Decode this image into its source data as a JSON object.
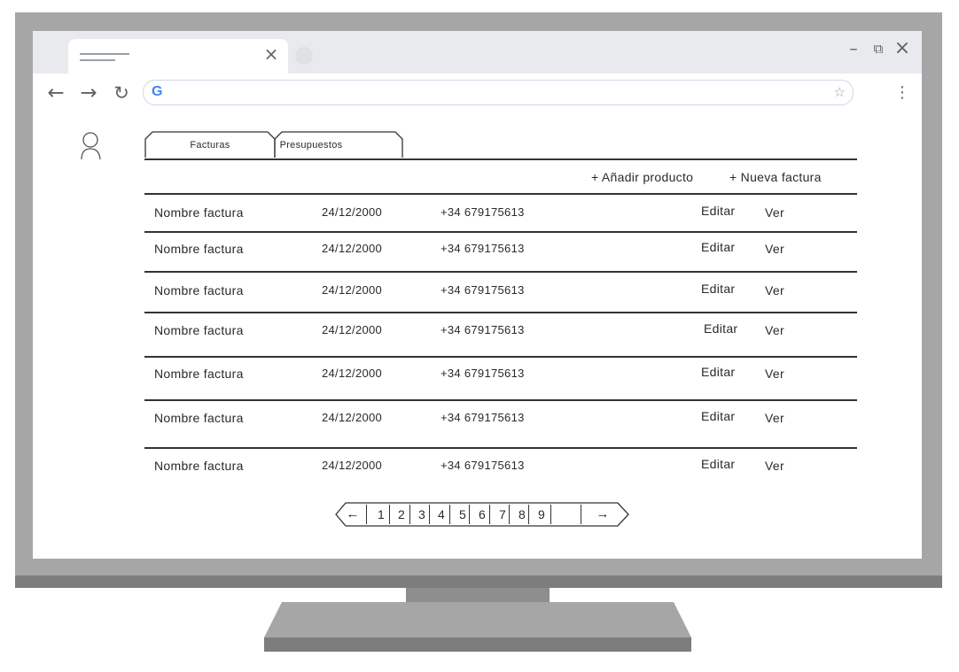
{
  "window": {
    "minimize": "–",
    "restore": "⧉",
    "close": "×",
    "tab_close": "×"
  },
  "toolbar": {
    "back": "←",
    "forward": "→",
    "reload": "↻",
    "search_logo": "G",
    "bookmark": "☆",
    "menu": "⋮"
  },
  "tabs": [
    "Facturas",
    "Presupuestos"
  ],
  "actions": {
    "add_product": "+ Añadir producto",
    "new_invoice": "+ Nueva factura"
  },
  "rows": [
    {
      "name": "Nombre factura",
      "date": "24/12/2000",
      "phone": "+34 679175613",
      "edit": "Editar",
      "view": "Ver"
    },
    {
      "name": "Nombre factura",
      "date": "24/12/2000",
      "phone": "+34 679175613",
      "edit": "Editar",
      "view": "Ver"
    },
    {
      "name": "Nombre factura",
      "date": "24/12/2000",
      "phone": "+34 679175613",
      "edit": "Editar",
      "view": "Ver"
    },
    {
      "name": "Nombre factura",
      "date": "24/12/2000",
      "phone": "+34 679175613",
      "edit": "Editar",
      "view": "Ver"
    },
    {
      "name": "Nombre factura",
      "date": "24/12/2000",
      "phone": "+34 679175613",
      "edit": "Editar",
      "view": "Ver"
    },
    {
      "name": "Nombre factura",
      "date": "24/12/2000",
      "phone": "+34 679175613",
      "edit": "Editar",
      "view": "Ver"
    },
    {
      "name": "Nombre factura",
      "date": "24/12/2000",
      "phone": "+34 679175613",
      "edit": "Editar",
      "view": "Ver"
    }
  ],
  "pagination": {
    "prev": "←",
    "pages": [
      "1",
      "2",
      "3",
      "4",
      "5",
      "6",
      "7",
      "8",
      "9"
    ],
    "next": "→"
  },
  "icons": {
    "avatar": "user-icon",
    "google": "google-icon",
    "star": "star-icon"
  },
  "colors": {
    "monitor": "#a6a6a6",
    "tabstrip": "#e8eaed",
    "ink": "#2a2a2a"
  }
}
